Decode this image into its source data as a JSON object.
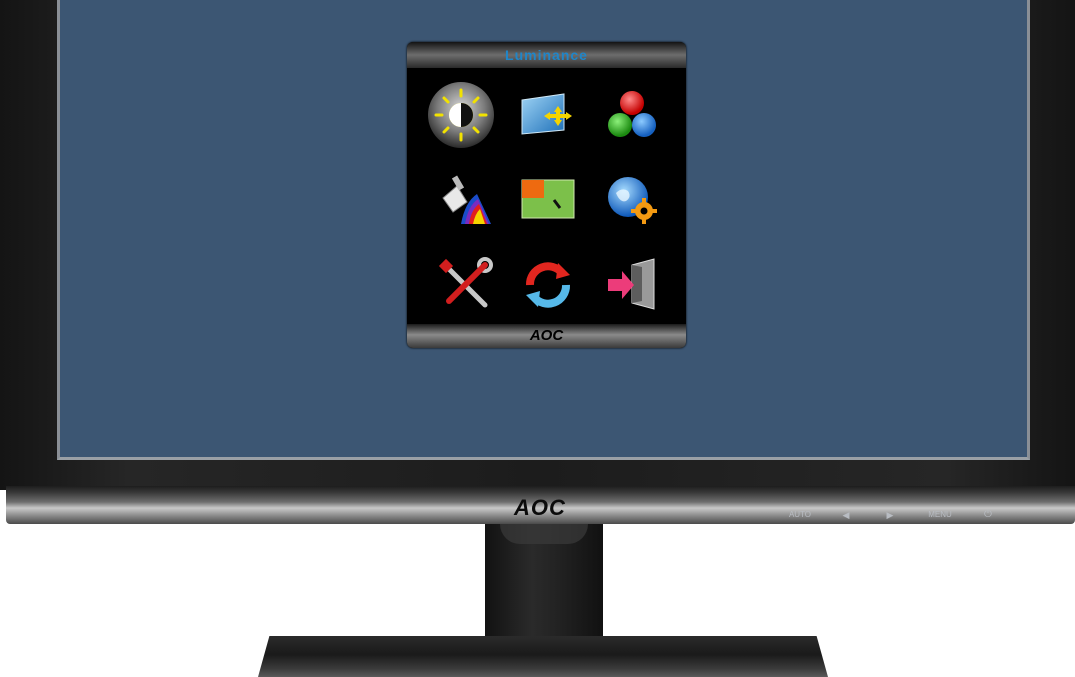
{
  "monitor": {
    "brand_logo": "AOC",
    "buttons": [
      {
        "label": "AUTO"
      },
      {
        "label": "◀"
      },
      {
        "label": "▶"
      },
      {
        "label": "MENU"
      },
      {
        "label": "⏻"
      }
    ]
  },
  "osd": {
    "title": "Luminance",
    "footer_logo": "AOC",
    "items": [
      {
        "icon": "luminance-icon",
        "selected": true
      },
      {
        "icon": "image-setup-icon"
      },
      {
        "icon": "color-temp-icon"
      },
      {
        "icon": "color-boost-icon"
      },
      {
        "icon": "picture-boost-icon"
      },
      {
        "icon": "osd-setup-icon"
      },
      {
        "icon": "extra-icon"
      },
      {
        "icon": "reset-icon"
      },
      {
        "icon": "exit-icon"
      }
    ]
  },
  "colors": {
    "screen_bg": "#3c5673",
    "osd_title": "#1f86c9",
    "osd_bg": "#000000"
  }
}
